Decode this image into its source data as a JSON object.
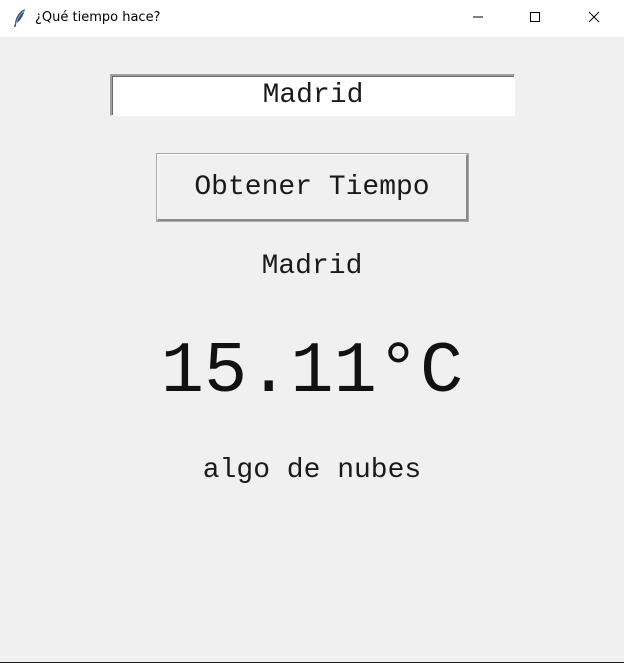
{
  "window": {
    "title": "¿Qué tiempo hace?",
    "icon": "feather-icon",
    "controls": {
      "minimize_icon": "minimize-icon",
      "maximize_icon": "maximize-icon",
      "close_icon": "close-icon"
    }
  },
  "form": {
    "city_input_value": "Madrid",
    "button_label": "Obtener Tiempo"
  },
  "weather": {
    "city": "Madrid",
    "temperature": "15.11°C",
    "description": "algo de nubes"
  },
  "colors": {
    "background": "#f0f0f0",
    "titlebar": "#ffffff",
    "text": "#1a1a1a"
  }
}
